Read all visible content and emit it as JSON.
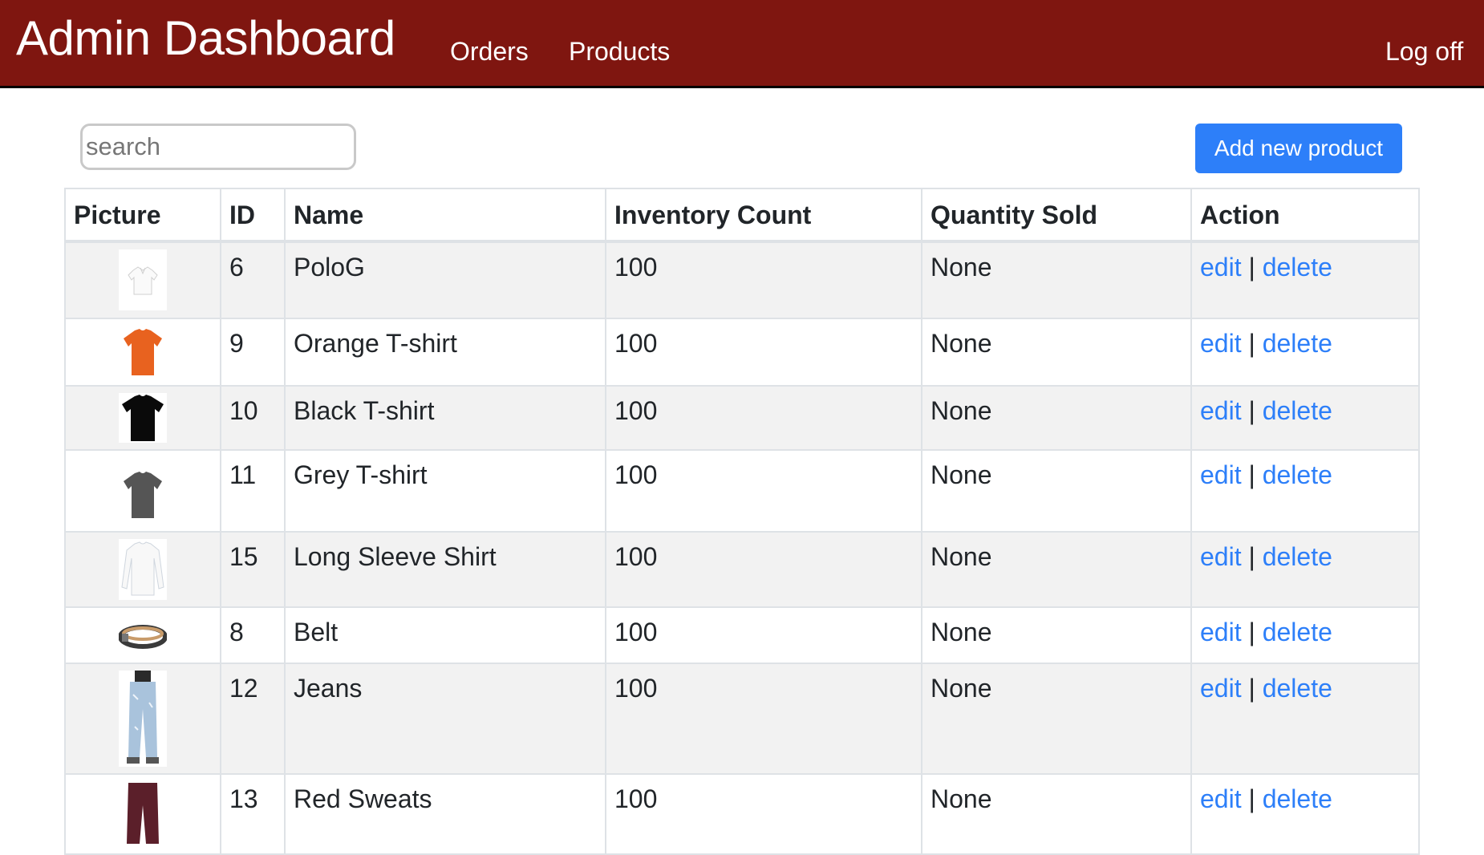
{
  "header": {
    "brand": "Admin Dashboard",
    "nav": {
      "orders": "Orders",
      "products": "Products"
    },
    "logoff": "Log off"
  },
  "toolbar": {
    "search_placeholder": "search",
    "add_label": "Add new product"
  },
  "table": {
    "headers": [
      "Picture",
      "ID",
      "Name",
      "Inventory Count",
      "Quantity Sold",
      "Action"
    ],
    "edit_label": "edit",
    "separator": "|",
    "delete_label": "delete",
    "rows": [
      {
        "id": "6",
        "name": "PoloG",
        "inventory": "100",
        "sold": "None",
        "picture": "white-polo-icon"
      },
      {
        "id": "9",
        "name": "Orange T-shirt",
        "inventory": "100",
        "sold": "None",
        "picture": "orange-tshirt-icon"
      },
      {
        "id": "10",
        "name": "Black T-shirt",
        "inventory": "100",
        "sold": "None",
        "picture": "black-tshirt-icon"
      },
      {
        "id": "11",
        "name": "Grey T-shirt",
        "inventory": "100",
        "sold": "None",
        "picture": "grey-tshirt-icon"
      },
      {
        "id": "15",
        "name": "Long Sleeve Shirt",
        "inventory": "100",
        "sold": "None",
        "picture": "white-longsleeve-icon"
      },
      {
        "id": "8",
        "name": "Belt",
        "inventory": "100",
        "sold": "None",
        "picture": "belt-icon"
      },
      {
        "id": "12",
        "name": "Jeans",
        "inventory": "100",
        "sold": "None",
        "picture": "jeans-icon"
      },
      {
        "id": "13",
        "name": "Red Sweats",
        "inventory": "100",
        "sold": "None",
        "picture": "red-sweats-icon"
      }
    ]
  },
  "colors": {
    "navbar": "#7f1610",
    "accent": "#2d7ff9",
    "stripe": "#f2f2f2"
  }
}
